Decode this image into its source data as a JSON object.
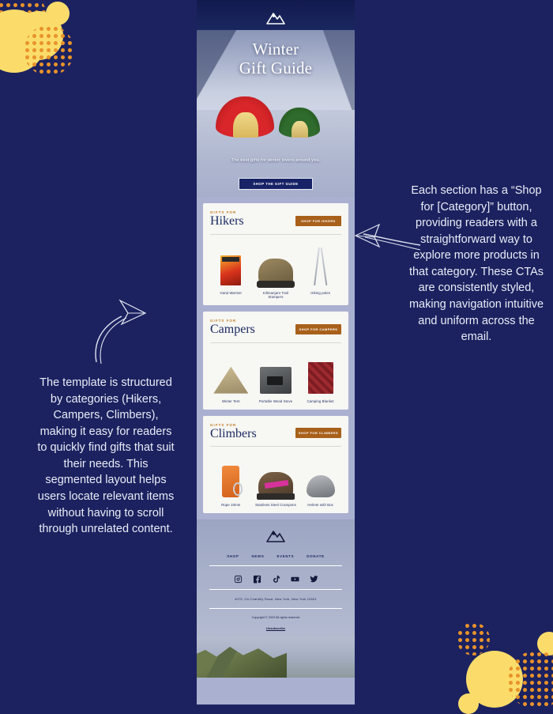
{
  "page": {
    "background_color": "#1c2260",
    "accent_yellow": "#fbdc6a",
    "accent_orange": "#e8922b",
    "email_brand_navy": "#1c2a63",
    "email_cta_brown": "#a8601b"
  },
  "annotations": {
    "left": "The template is structured by categories (Hikers, Campers, Climbers), making it easy for readers to quickly find gifts that suit their needs. This segmented layout helps users locate relevant items without having to scroll through unrelated content.",
    "right": "Each section has a “Shop for [Category]” button, providing readers with a straightforward way to explore more products in that category. These CTAs are consistently styled, making navigation intuitive and uniform across the email."
  },
  "email": {
    "hero": {
      "logo": "mountain-logo",
      "title_line1": "Winter",
      "title_line2": "Gift Guide",
      "subtitle": "The best gifts for winter lovers around you.",
      "cta_label": "SHOP THE GIFT GUIDE"
    },
    "sections": [
      {
        "eyebrow": "GIFTS FOR",
        "title": "Hikers",
        "cta_label": "SHOP FOR HIKERS",
        "products": [
          {
            "name": "Hand Warmer",
            "art": "handwarmer"
          },
          {
            "name": "Kilimanjaro Trail Stompers",
            "art": "boot"
          },
          {
            "name": "Hiking poles",
            "art": "poles"
          }
        ]
      },
      {
        "eyebrow": "GIFTS FOR",
        "title": "Campers",
        "cta_label": "SHOP FOR CAMPERS",
        "products": [
          {
            "name": "Winter Tent",
            "art": "tent"
          },
          {
            "name": "Portable Wood Stove",
            "art": "stove"
          },
          {
            "name": "Camping Blanket",
            "art": "blanket"
          }
        ]
      },
      {
        "eyebrow": "GIFTS FOR",
        "title": "Climbers",
        "cta_label": "SHOP FOR CLIMBERS",
        "products": [
          {
            "name": "Rope 10mm",
            "art": "rope"
          },
          {
            "name": "Stainless Steel Crampons",
            "art": "crampon"
          },
          {
            "name": "Helmet with Box",
            "art": "helmet"
          }
        ]
      }
    ],
    "footer": {
      "logo": "mountain-logo",
      "nav": [
        "SHOP",
        "NEWS",
        "EVENTS",
        "DONATE"
      ],
      "socials": [
        "instagram-icon",
        "facebook-icon",
        "tiktok-icon",
        "youtube-icon",
        "twitter-icon"
      ],
      "address": "4075, On Chantilly Road, New York, New York 10001",
      "copyright": "Copyright © 2023 All rights reserved",
      "unsubscribe": "Unsubscribe"
    }
  }
}
